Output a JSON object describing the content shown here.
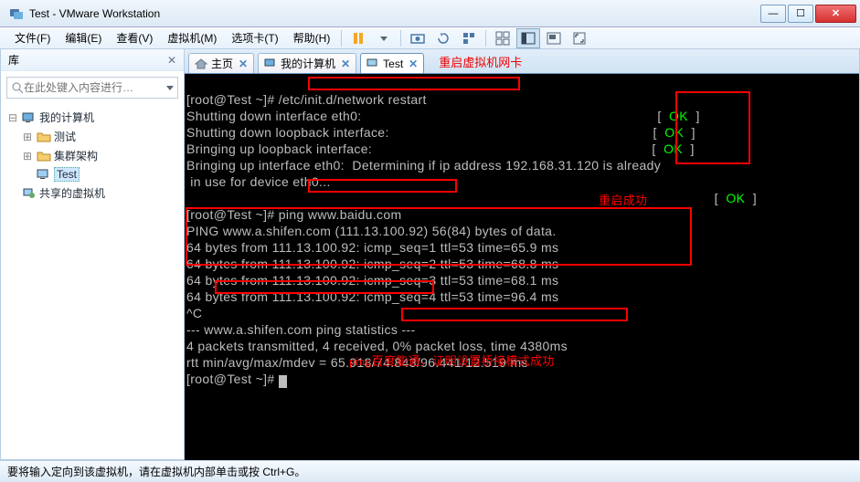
{
  "window": {
    "title": "Test - VMware Workstation"
  },
  "winbtns": {
    "min": "—",
    "max": "☐",
    "close": "✕"
  },
  "menus": {
    "file": "文件(F)",
    "edit": "编辑(E)",
    "view": "查看(V)",
    "vm": "虚拟机(M)",
    "tabs": "选项卡(T)",
    "help": "帮助(H)"
  },
  "sidebar": {
    "title": "库",
    "close": "✕",
    "search_placeholder": "在此处键入内容进行…",
    "root": "我的计算机",
    "items": [
      "测试",
      "集群架构",
      "Test"
    ],
    "shared": "共享的虚拟机"
  },
  "tabs": {
    "home": "主页",
    "mycomp": "我的计算机",
    "test": "Test",
    "x": "✕"
  },
  "annotations": {
    "restart": "重启虚拟机网卡",
    "success": "重启成功",
    "ping": "ping百度能通，证明设置桥接模式成功"
  },
  "term": {
    "l0a": "[root@Test ~]# ",
    "l0b": "/etc/init.d/network restart",
    "l1": "Shutting down interface eth0:",
    "l2": "Shutting down loopback interface:",
    "l3": "Bringing up loopback interface:",
    "l4": "Bringing up interface eth0:  Determining if ip address 192.168.31.120 is already",
    "l5": " in use for device eth0...",
    "okL": "[  ",
    "ok": "OK",
    "okR": "  ]",
    "l7a": "[root@Test ~]# ",
    "l7b": "ping www.baidu.com",
    "l8": "PING www.a.shifen.com (111.13.100.92) 56(84) bytes of data.",
    "p1": "64 bytes from 111.13.100.92: icmp_seq=1 ttl=53 time=65.9 ms",
    "p2": "64 bytes from 111.13.100.92: icmp_seq=2 ttl=53 time=68.8 ms",
    "p3": "64 bytes from 111.13.100.92: icmp_seq=3 ttl=53 time=68.1 ms",
    "p4": "64 bytes from 111.13.100.92: icmp_seq=4 ttl=53 time=96.4 ms",
    "ctrlc": "^C",
    "s1": "--- www.a.shifen.com ping statistics ---",
    "s2a": "4 packets transmitted, ",
    "s2b": "4 received, 0% packet loss",
    "s2c": ", time 4380ms",
    "s3": "rtt min/avg/max/mdev = 65.918/74.843/96.441/12.519 ms",
    "lE": "[root@Test ~]# "
  },
  "status": {
    "text": "要将输入定向到该虚拟机，请在虚拟机内部单击或按 Ctrl+G。"
  }
}
